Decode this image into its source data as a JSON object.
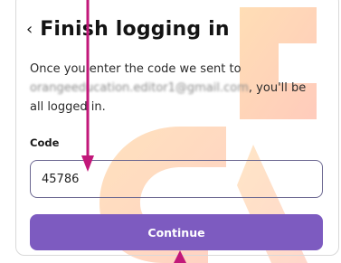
{
  "title": "Finish logging in",
  "back_icon": "chevron-left-icon",
  "description": {
    "before": "Once you enter the code we sent to ",
    "email": "orangeeducation.editor1@gmail.com",
    "after": ", you'll be all logged in."
  },
  "code_field": {
    "label": "Code",
    "value": "45786"
  },
  "continue_label": "Continue",
  "colors": {
    "accent": "#7d5bc0",
    "arrow": "#c2187a",
    "watermark": "#f5a623"
  }
}
